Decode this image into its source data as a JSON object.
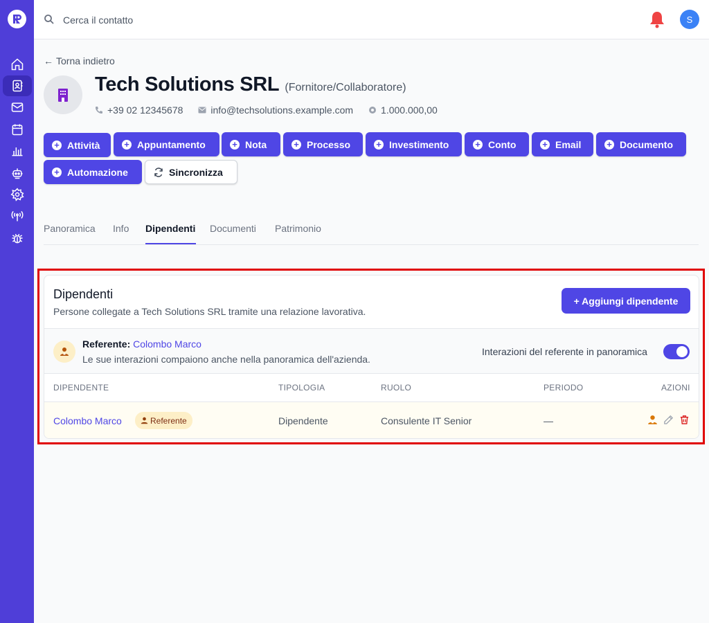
{
  "search": {
    "placeholder": "Cerca il contatto"
  },
  "user": {
    "initial": "S"
  },
  "sidebar": {
    "icons": [
      "home-icon",
      "contacts-icon",
      "mail-icon",
      "calendar-icon",
      "chart-icon",
      "robot-icon",
      "settings-icon",
      "antenna-icon",
      "bug-icon"
    ]
  },
  "back_label": "Torna indietro",
  "company": {
    "name": "Tech Solutions SRL",
    "type": "(Fornitore/Collaboratore)",
    "phone": "+39 02 12345678",
    "email": "info@techsolutions.example.com",
    "capital": "1.000.000,00"
  },
  "actions": [
    "Attività",
    "Appuntamento",
    "Nota",
    "Processo",
    "Investimento",
    "Conto",
    "Email",
    "Documento",
    "Automazione"
  ],
  "sync_label": "Sincronizza",
  "tabs": [
    "Panoramica",
    "Info",
    "Dipendenti",
    "Documenti",
    "Patrimonio"
  ],
  "active_tab": "Dipendenti",
  "employees": {
    "title": "Dipendenti",
    "subtitle": "Persone collegate a Tech Solutions SRL tramite una relazione lavorativa.",
    "add_label": "+ Aggiungi dipendente",
    "referent": {
      "label": "Referente:",
      "name": "Colombo Marco",
      "description": "Le sue interazioni compaiono anche nella panoramica dell'azienda.",
      "toggle_label": "Interazioni del referente in panoramica",
      "toggle_on": true
    },
    "headers": {
      "employee": "DIPENDENTE",
      "type": "TIPOLOGIA",
      "role": "RUOLO",
      "period": "PERIODO",
      "actions": "AZIONI"
    },
    "rows": [
      {
        "name": "Colombo Marco",
        "badge": "Referente",
        "type": "Dipendente",
        "role": "Consulente IT Senior",
        "period": "—"
      }
    ]
  },
  "colors": {
    "sidebar": "#4f3ed8",
    "accent": "#4f46e5",
    "bell": "#ef4444",
    "highlight": "#e00000"
  }
}
